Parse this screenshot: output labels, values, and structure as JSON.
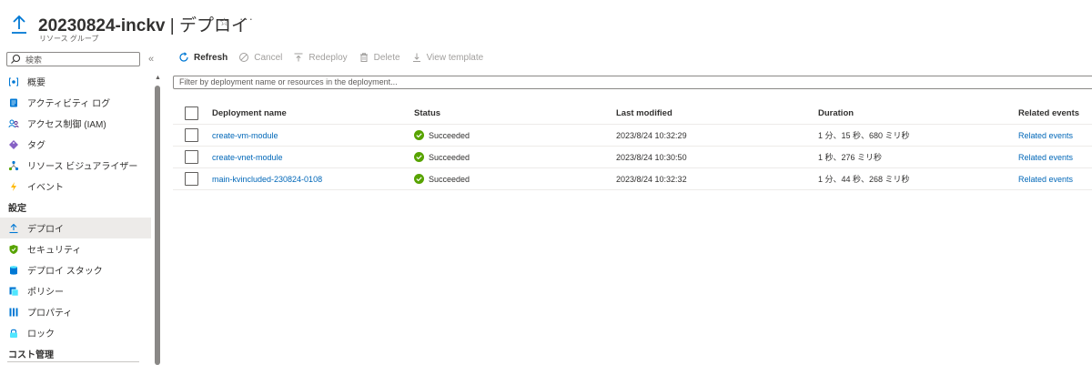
{
  "header": {
    "title_bold": "20230824-inckv",
    "title_rest": " | デプロイ",
    "subtitle": "リソース グループ",
    "star_glyph": "☆",
    "more_glyph": "···"
  },
  "sidebar": {
    "search_placeholder": "検索",
    "collapse_glyph": "«",
    "items": [
      {
        "label": "概要",
        "icon": "overview-icon"
      },
      {
        "label": "アクティビティ ログ",
        "icon": "activity-log-icon"
      },
      {
        "label": "アクセス制御 (IAM)",
        "icon": "access-control-icon"
      },
      {
        "label": "タグ",
        "icon": "tag-icon"
      },
      {
        "label": "リソース ビジュアライザー",
        "icon": "resource-visualizer-icon"
      },
      {
        "label": "イベント",
        "icon": "events-icon"
      }
    ],
    "section_settings": "設定",
    "settings_items": [
      {
        "label": "デプロイ",
        "icon": "deployments-icon",
        "active": true
      },
      {
        "label": "セキュリティ",
        "icon": "security-icon"
      },
      {
        "label": "デプロイ スタック",
        "icon": "deployment-stacks-icon"
      },
      {
        "label": "ポリシー",
        "icon": "policies-icon"
      },
      {
        "label": "プロパティ",
        "icon": "properties-icon"
      },
      {
        "label": "ロック",
        "icon": "locks-icon"
      }
    ],
    "section_cost": "コスト管理"
  },
  "toolbar": {
    "refresh": "Refresh",
    "cancel": "Cancel",
    "redeploy": "Redeploy",
    "delete": "Delete",
    "view_template": "View template"
  },
  "filter": {
    "placeholder": "Filter by deployment name or resources in the deployment..."
  },
  "table": {
    "columns": {
      "name": "Deployment name",
      "status": "Status",
      "last_modified": "Last modified",
      "duration": "Duration",
      "related_events": "Related events"
    },
    "rows": [
      {
        "name": "create-vm-module",
        "status": "Succeeded",
        "last_modified": "2023/8/24 10:32:29",
        "duration": "1 分、15 秒、680 ミリ秒",
        "related_events": "Related events"
      },
      {
        "name": "create-vnet-module",
        "status": "Succeeded",
        "last_modified": "2023/8/24 10:30:50",
        "duration": "1 秒、276 ミリ秒",
        "related_events": "Related events"
      },
      {
        "name": "main-kvincluded-230824-0108",
        "status": "Succeeded",
        "last_modified": "2023/8/24 10:32:32",
        "duration": "1 分、44 秒、268 ミリ秒",
        "related_events": "Related events"
      }
    ]
  },
  "colors": {
    "link": "#0067b8",
    "success": "#57a300",
    "active_bg": "#edebe9",
    "accent": "#0078d4"
  }
}
